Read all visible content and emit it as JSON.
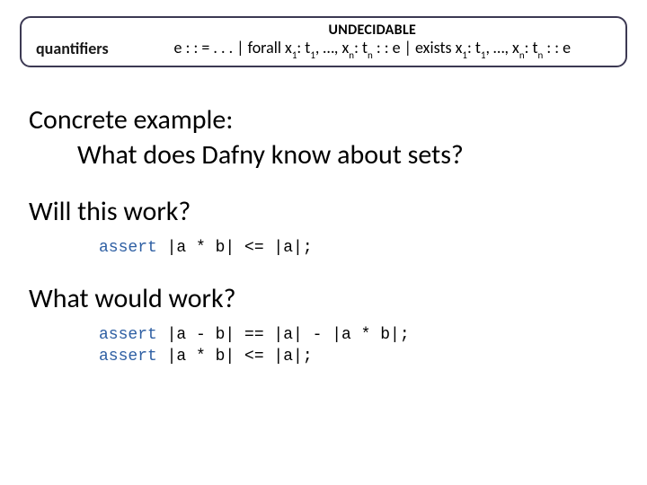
{
  "header": {
    "label": "quantifiers",
    "title": "UNDECIDABLE",
    "grammar_html": "e : : = . . . | forall x<sub>1</sub>: t<sub>1</sub>, …, x<sub>n</sub>: t<sub>n</sub> : : e | exists x<sub>1</sub>: t<sub>1</sub>, …, x<sub>n</sub>: t<sub>n</sub> : : e"
  },
  "body": {
    "concrete": "Concrete example:",
    "q_sets": "What does Dafny know about sets?",
    "will_work": "Will this work?",
    "code1_kw": "assert",
    "code1_rest": " |a * b| <= |a|;",
    "would_work": "What would work?",
    "code2a_kw": "assert",
    "code2a_rest": " |a - b| == |a| - |a * b|;",
    "code2b_kw": "assert",
    "code2b_rest": " |a * b| <= |a|;"
  }
}
